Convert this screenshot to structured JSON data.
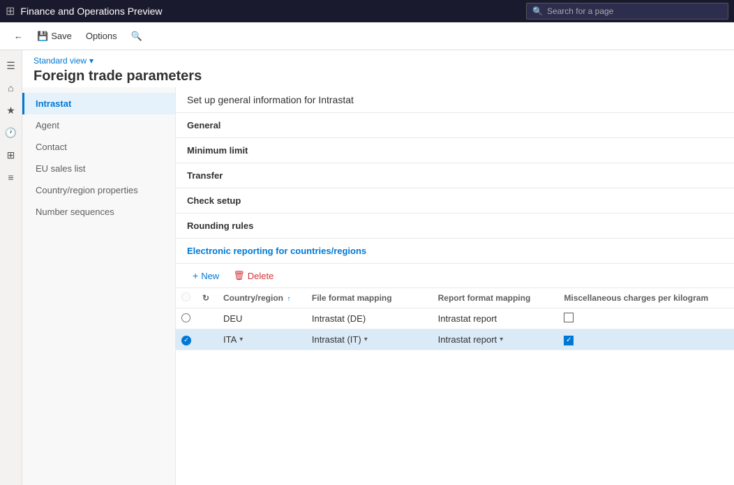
{
  "app": {
    "title": "Finance and Operations Preview",
    "search_placeholder": "Search for a page"
  },
  "toolbar": {
    "back_label": "Back",
    "save_label": "Save",
    "options_label": "Options",
    "search_label": "Search"
  },
  "page": {
    "standard_view": "Standard view",
    "title": "Foreign trade parameters",
    "subtitle": "Set up general information for Intrastat"
  },
  "nav_items": [
    {
      "id": "intrastat",
      "label": "Intrastat",
      "active": true
    },
    {
      "id": "agent",
      "label": "Agent",
      "active": false
    },
    {
      "id": "contact",
      "label": "Contact",
      "active": false
    },
    {
      "id": "eu-sales",
      "label": "EU sales list",
      "active": false
    },
    {
      "id": "country-region",
      "label": "Country/region properties",
      "active": false
    },
    {
      "id": "number-sequences",
      "label": "Number sequences",
      "active": false
    }
  ],
  "sections": [
    {
      "id": "general",
      "label": "General"
    },
    {
      "id": "minimum-limit",
      "label": "Minimum limit"
    },
    {
      "id": "transfer",
      "label": "Transfer"
    },
    {
      "id": "check-setup",
      "label": "Check setup"
    },
    {
      "id": "rounding-rules",
      "label": "Rounding rules"
    }
  ],
  "electronic_reporting": {
    "title": "Electronic reporting for countries/regions",
    "new_label": "New",
    "delete_label": "Delete",
    "columns": [
      {
        "id": "select",
        "label": ""
      },
      {
        "id": "refresh",
        "label": ""
      },
      {
        "id": "country",
        "label": "Country/region"
      },
      {
        "id": "file-format",
        "label": "File format mapping"
      },
      {
        "id": "report-format",
        "label": "Report format mapping"
      },
      {
        "id": "misc-charges",
        "label": "Miscellaneous charges per kilogram"
      }
    ],
    "rows": [
      {
        "id": "row-deu",
        "selected": false,
        "country": "DEU",
        "file_format": "Intrastat (DE)",
        "report_format": "Intrastat report",
        "misc_checked": false
      },
      {
        "id": "row-ita",
        "selected": true,
        "country": "ITA",
        "file_format": "Intrastat (IT)",
        "report_format": "Intrastat report",
        "misc_checked": true
      }
    ]
  },
  "side_icons": [
    {
      "id": "menu",
      "symbol": "☰"
    },
    {
      "id": "home",
      "symbol": "⌂"
    },
    {
      "id": "favorites",
      "symbol": "★"
    },
    {
      "id": "recent",
      "symbol": "⏱"
    },
    {
      "id": "workspaces",
      "symbol": "⊞"
    },
    {
      "id": "modules",
      "symbol": "≡"
    }
  ]
}
